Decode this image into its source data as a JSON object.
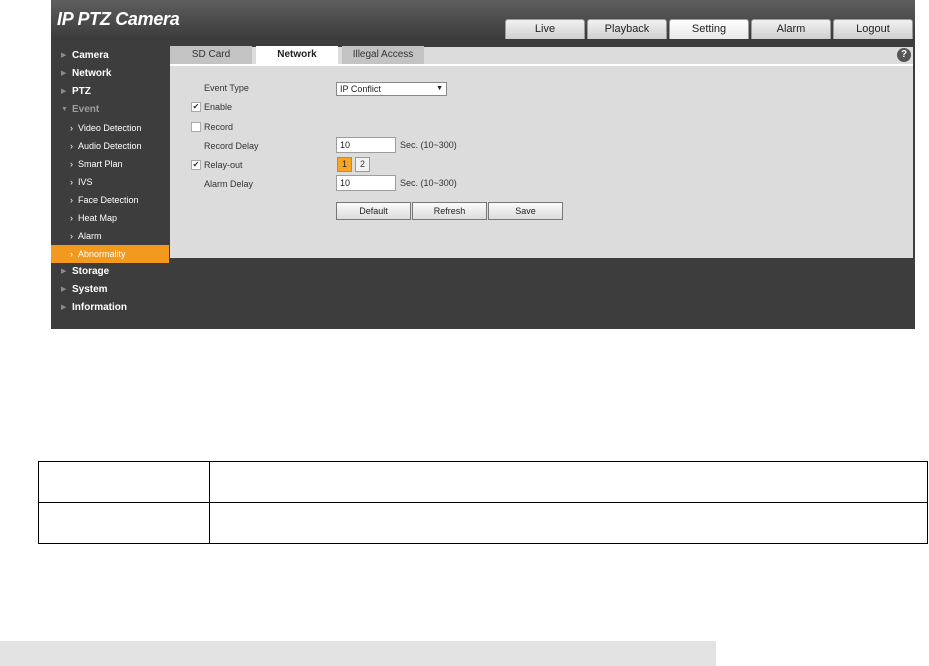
{
  "header": {
    "logo": "IP PTZ Camera",
    "nav": [
      "Live",
      "Playback",
      "Setting",
      "Alarm",
      "Logout"
    ],
    "active_nav": "Setting"
  },
  "sidebar": {
    "camera": "Camera",
    "network": "Network",
    "ptz": "PTZ",
    "event": "Event",
    "event_items": [
      "Video Detection",
      "Audio Detection",
      "Smart Plan",
      "IVS",
      "Face Detection",
      "Heat Map",
      "Alarm",
      "Abnormality"
    ],
    "storage": "Storage",
    "system": "System",
    "information": "Information"
  },
  "tabs": [
    "SD Card",
    "Network",
    "Illegal Access"
  ],
  "form": {
    "event_type_label": "Event Type",
    "event_type_value": "IP Conflict",
    "enable_label": "Enable",
    "enable_checked": true,
    "record_label": "Record",
    "record_checked": false,
    "record_delay_label": "Record Delay",
    "record_delay_value": "10",
    "record_delay_unit": "Sec. (10~300)",
    "relay_out_label": "Relay-out",
    "relay_out_checked": true,
    "relay_channels": [
      "1",
      "2"
    ],
    "alarm_delay_label": "Alarm Delay",
    "alarm_delay_value": "10",
    "alarm_delay_unit": "Sec. (10~300)"
  },
  "buttons": {
    "default": "Default",
    "refresh": "Refresh",
    "save": "Save"
  },
  "colors": {
    "accent": "#f39a1e",
    "sidebar_bg": "#3d3d3d",
    "content_bg": "#dcdcdc"
  }
}
